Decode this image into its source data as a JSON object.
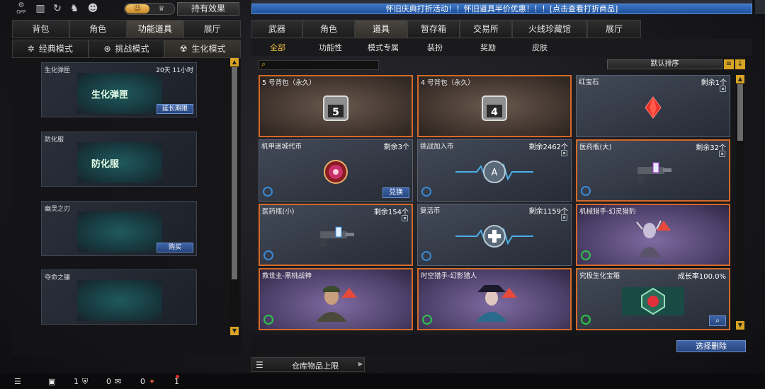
{
  "topbar": {
    "off_label": "OFF",
    "icons": [
      "off-toggle-icon",
      "ranking-icon",
      "refresh-icon",
      "character-icon",
      "mascot-icon"
    ],
    "toggle_on_icon": "avatar-icon",
    "toggle_off_icon": "emblem-icon",
    "effect_button": "持有效果"
  },
  "banner": {
    "text": "怀旧庆典打折活动！！怀旧道具半价优惠！！！[点击查看打折商品]"
  },
  "left": {
    "tabs": [
      {
        "label": "背包",
        "active": false
      },
      {
        "label": "角色",
        "active": false
      },
      {
        "label": "功能道具",
        "active": true
      },
      {
        "label": "展厅",
        "active": false
      }
    ],
    "modes": [
      {
        "label": "经典模式",
        "icon": "classic-mode-icon",
        "active": false
      },
      {
        "label": "挑战模式",
        "icon": "challenge-mode-icon",
        "active": false
      },
      {
        "label": "生化模式",
        "icon": "biochem-mode-icon",
        "active": true
      }
    ],
    "items": [
      {
        "name": "生化弹匣",
        "time": "20天 11小时",
        "art_label": "生化弹匣",
        "button": "延长期限"
      },
      {
        "name": "防化服",
        "time": "",
        "art_label": "防化服",
        "button": ""
      },
      {
        "name": "幽灵之刃",
        "time": "",
        "art_label": "",
        "button": "购买"
      },
      {
        "name": "夺命之镰",
        "time": "",
        "art_label": "",
        "button": ""
      }
    ]
  },
  "right": {
    "tabs": [
      {
        "label": "武器",
        "active": false
      },
      {
        "label": "角色",
        "active": false
      },
      {
        "label": "道具",
        "active": true
      },
      {
        "label": "暂存箱",
        "active": false
      },
      {
        "label": "交易所",
        "active": false
      },
      {
        "label": "火线珍藏馆",
        "active": false
      },
      {
        "label": "展厅",
        "active": false
      }
    ],
    "subtabs": [
      {
        "label": "全部",
        "active": true
      },
      {
        "label": "功能性",
        "active": false
      },
      {
        "label": "模式专属",
        "active": false
      },
      {
        "label": "装扮",
        "active": false
      },
      {
        "label": "奖励",
        "active": false
      },
      {
        "label": "皮肤",
        "active": false
      }
    ],
    "sort_label": "默认排序",
    "items": [
      {
        "name": "5 号背包（永久）",
        "qty": "",
        "style": "brown",
        "art": "背包5"
      },
      {
        "name": "4 号背包（永久）",
        "qty": "",
        "style": "brown",
        "art": "背包4"
      },
      {
        "name": "红宝石",
        "qty": "剩余1个",
        "style": "blue",
        "art": "ruby"
      },
      {
        "name": "机甲迷城代币",
        "qty": "剩余3个",
        "style": "blue",
        "art": "token",
        "action": "兑换"
      },
      {
        "name": "挑战加入币",
        "qty": "剩余2462个",
        "style": "blue",
        "art": "coin"
      },
      {
        "name": "医药瓶(大)",
        "qty": "剩余32个",
        "style": "blue",
        "art": "gun"
      },
      {
        "name": "医药瓶(小)",
        "qty": "剩余154个",
        "style": "blue",
        "art": "gun"
      },
      {
        "name": "复活币",
        "qty": "剩余1159个",
        "style": "blue",
        "art": "coin"
      },
      {
        "name": "机械猎手-幻灵猎豹",
        "qty": "",
        "style": "purple",
        "art": "character"
      },
      {
        "name": "救世主-黑桃战神",
        "qty": "",
        "style": "purple",
        "art": "character"
      },
      {
        "name": "时空猎手-幻影猎人",
        "qty": "",
        "style": "purple",
        "art": "character"
      },
      {
        "name": "究极生化宝箱",
        "qty": "成长率100.0%",
        "style": "blue",
        "art": "chest",
        "action_icon": "magnifier-icon"
      }
    ],
    "bulk_delete": "选择删除",
    "storage_limit": "仓库物品上限"
  },
  "status": {
    "count1": "1",
    "count2": "0",
    "count3": "0",
    "count4": "1"
  }
}
